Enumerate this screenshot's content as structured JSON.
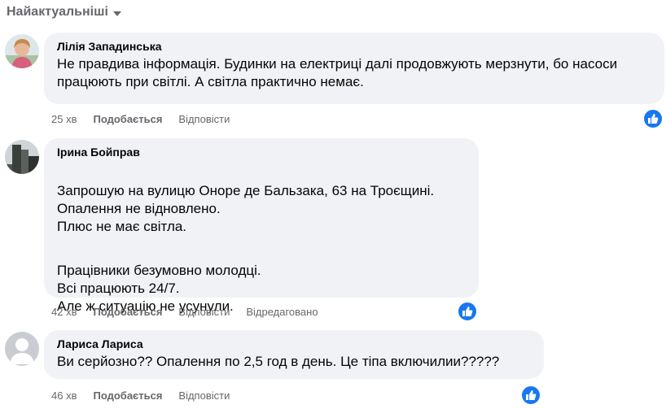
{
  "sort": {
    "label": "Найактуальніші"
  },
  "comments": [
    {
      "author": "Лілія Западинська",
      "paragraphs": [
        "Не правдива інформація. Будинки на електриці далі продовжують мерзнути, бо насоси працюють при світлі. А світла практично немає."
      ],
      "time": "25 хв",
      "like_label": "Подобається",
      "reply_label": "Відповісти",
      "edited_label": "",
      "reaction": "like-reaction-icon"
    },
    {
      "author": "Ірина Бойправ",
      "paragraphs": [
        "Запрошую на вулицю Оноре де Бальзака, 63 на Троєщині.\nОпалення не відновлено.\nПлюс не має світла.",
        "Працівники безумовно молодці.\nВсі працюють 24/7.\nАле ж ситуацію не усунули."
      ],
      "time": "42 хв",
      "like_label": "Подобається",
      "reply_label": "Відповісти",
      "edited_label": "Відредаговано",
      "reaction": "like-reaction-icon"
    },
    {
      "author": "Лариса Лариса",
      "paragraphs": [
        "Ви серйозно?? Опалення по 2,5 год в день. Це тіпа включилии?????"
      ],
      "time": "46 хв",
      "like_label": "Подобається",
      "reply_label": "Відповісти",
      "edited_label": "",
      "reaction": "like-reaction-icon"
    }
  ],
  "colors": {
    "bubble": "#f0f2f5",
    "meta": "#65676b",
    "reaction": "#1877f2"
  }
}
